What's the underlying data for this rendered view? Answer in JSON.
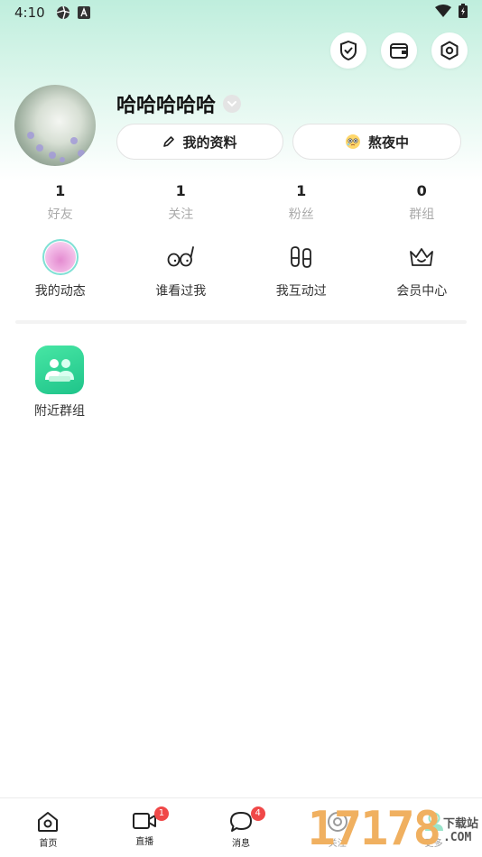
{
  "status_bar": {
    "time": "4:10"
  },
  "profile": {
    "nickname": "哈哈哈哈哈",
    "my_profile_label": "我的资料",
    "status_label": "熬夜中"
  },
  "stats": [
    {
      "value": "1",
      "label": "好友"
    },
    {
      "value": "1",
      "label": "关注"
    },
    {
      "value": "1",
      "label": "粉丝"
    },
    {
      "value": "0",
      "label": "群组"
    }
  ],
  "quick_actions": [
    {
      "label": "我的动态",
      "icon": "feed-avatar-icon"
    },
    {
      "label": "谁看过我",
      "icon": "glasses-icon"
    },
    {
      "label": "我互动过",
      "icon": "footprints-icon"
    },
    {
      "label": "会员中心",
      "icon": "crown-icon"
    }
  ],
  "tools": [
    {
      "label": "附近群组",
      "icon": "nearby-group-icon"
    }
  ],
  "tabbar": [
    {
      "label": "首页",
      "icon": "home-icon",
      "badge": ""
    },
    {
      "label": "直播",
      "icon": "video-icon",
      "badge": "1"
    },
    {
      "label": "消息",
      "icon": "chat-icon",
      "badge": "4"
    },
    {
      "label": "关注",
      "icon": "eye-icon",
      "badge": ""
    },
    {
      "label": "更多",
      "icon": "person-icon",
      "badge": ""
    }
  ],
  "watermark": {
    "number": "17178",
    "site": "下载站",
    "domain": ".COM"
  },
  "colors": {
    "accent": "#1fc48a",
    "badge": "#f04848",
    "header_gradient": "#bfeedd"
  }
}
